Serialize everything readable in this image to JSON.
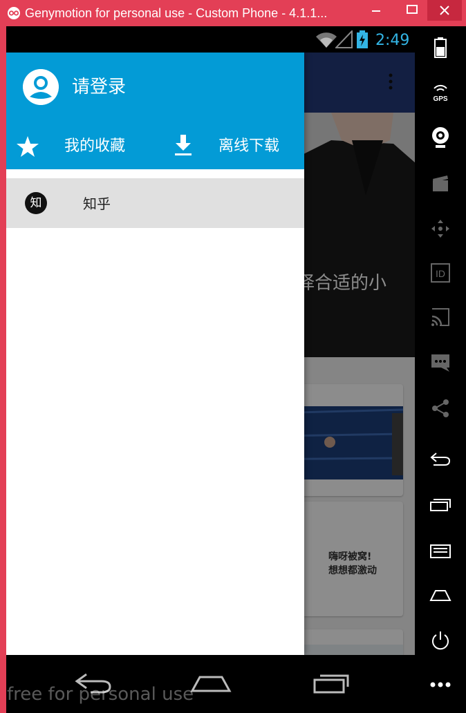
{
  "window": {
    "title": "Genymotion for personal use - Custom Phone - 4.1.1...",
    "accent": "#e33f56"
  },
  "statusbar": {
    "time": "2:49",
    "time_color": "#33b5e5"
  },
  "drawer": {
    "login_label": "请登录",
    "actions": {
      "favorites": "我的收藏",
      "download": "离线下载"
    },
    "menu": [
      {
        "icon_text": "知",
        "label": "知乎"
      }
    ],
    "header_color": "#039bd6"
  },
  "background_app": {
    "hero_caption": "择合适的小",
    "card_text_line1": "嗨呀被窝!",
    "card_text_line2": "想想都激动"
  },
  "watermark": "free for personal use",
  "sidebar_icons": [
    "battery-icon",
    "gps-icon",
    "webcam-icon",
    "clapper-icon",
    "dpad-icon",
    "id-icon",
    "cast-icon",
    "sms-icon",
    "share-icon",
    "back-icon",
    "recent-apps-icon",
    "menu-icon",
    "home-icon",
    "power-icon",
    "more-icon"
  ],
  "sidebar_labels": {
    "gps": "GPS",
    "id": "ID"
  }
}
